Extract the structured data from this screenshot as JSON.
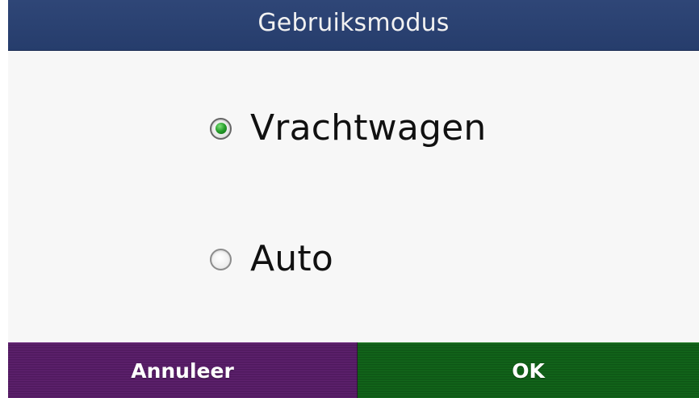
{
  "header": {
    "title": "Gebruiksmodus"
  },
  "options": [
    {
      "label": "Vrachtwagen",
      "selected": true,
      "icon": "radio-selected-icon"
    },
    {
      "label": "Auto",
      "selected": false,
      "icon": "radio-unselected-icon"
    }
  ],
  "buttons": {
    "cancel_label": "Annuleer",
    "ok_label": "OK"
  },
  "colors": {
    "title_bar": "#2b4271",
    "content_background": "#f7f7f7",
    "selected_radio": "#27a02c",
    "cancel_button": "#5d216d",
    "ok_button": "#12661a"
  }
}
